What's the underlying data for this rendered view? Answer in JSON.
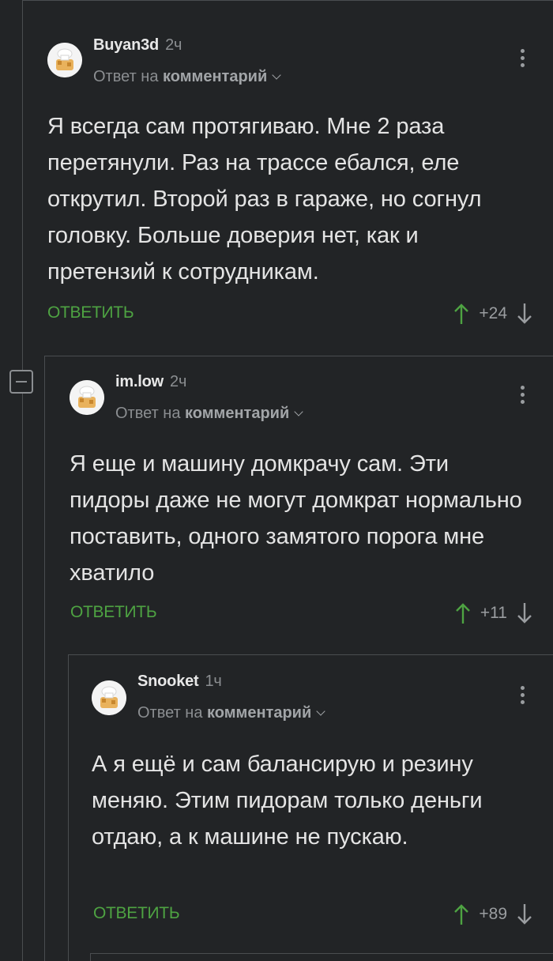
{
  "comments": [
    {
      "author": "Buyan3d",
      "time": "2ч",
      "reply_prefix": "Ответ на",
      "reply_target": "комментарий",
      "text": "Я всегда сам протягиваю. Мне 2 раза перетянули. Раз на трассе ебался, еле открутил. Второй раз в гараже, но согнул головку. Больше доверия нет, как и претензий к сотрудникам.",
      "reply_label": "ОТВЕТИТЬ",
      "score": "+24"
    },
    {
      "author": "im.low",
      "time": "2ч",
      "reply_prefix": "Ответ на",
      "reply_target": "комментарий",
      "text": "Я еще и машину домкрачу сам. Эти пидоры даже не могут домкрат нормально поставить, одного замятого порога мне хватило",
      "reply_label": "ОТВЕТИТЬ",
      "score": "+11"
    },
    {
      "author": "Snooket",
      "time": "1ч",
      "reply_prefix": "Ответ на",
      "reply_target": "комментарий",
      "text": "А я ещё и сам балансирую и резину меняю. Этим пидорам только деньги отдаю, а к машине не пускаю.",
      "reply_label": "ОТВЕТИТЬ",
      "score": "+89"
    }
  ],
  "colors": {
    "background": "#222426",
    "accent_green": "#4ea342",
    "muted": "#8b8e91"
  },
  "icons": {
    "avatar": "default-avatar-icon",
    "upvote": "arrow-up-icon",
    "downvote": "arrow-down-icon",
    "menu": "kebab-menu-icon",
    "collapse": "collapse-thread-icon"
  }
}
